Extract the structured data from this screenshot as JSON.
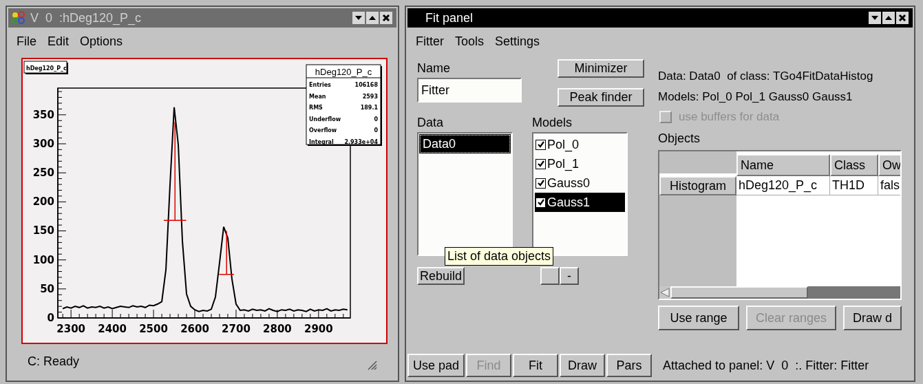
{
  "viewer": {
    "title": "V  0  :hDeg120_P_c",
    "menu": [
      "File",
      "Edit",
      "Options"
    ],
    "histogram": {
      "title_label": "hDeg120_P_c",
      "stats_title": "hDeg120_P_c",
      "stats": [
        {
          "label": "Entries",
          "value": "106168"
        },
        {
          "label": "Mean",
          "value": "2593"
        },
        {
          "label": "RMS",
          "value": "189.1"
        },
        {
          "label": "Underflow",
          "value": "0"
        },
        {
          "label": "Overflow",
          "value": "0"
        },
        {
          "label": "Integral",
          "value": "2.933e+04"
        }
      ],
      "chart_data": {
        "type": "line",
        "x": [
          2280,
          2290,
          2300,
          2310,
          2320,
          2330,
          2340,
          2350,
          2360,
          2370,
          2380,
          2390,
          2400,
          2410,
          2420,
          2430,
          2440,
          2450,
          2460,
          2470,
          2480,
          2490,
          2500,
          2510,
          2520,
          2530,
          2540,
          2550,
          2560,
          2570,
          2580,
          2590,
          2600,
          2610,
          2620,
          2630,
          2640,
          2650,
          2660,
          2670,
          2680,
          2690,
          2700,
          2710,
          2720,
          2730,
          2740,
          2750,
          2760,
          2770,
          2780,
          2790,
          2800,
          2810,
          2820,
          2830,
          2840,
          2850,
          2860,
          2870,
          2880,
          2890,
          2900,
          2910,
          2920,
          2930,
          2940,
          2950,
          2960,
          2970
        ],
        "series": [
          {
            "color": "#000000",
            "values": [
              16,
              19,
              17,
              20,
              18,
              21,
              17,
              19,
              18,
              20,
              17,
              19,
              16,
              18,
              20,
              19,
              18,
              21,
              19,
              20,
              18,
              22,
              21,
              24,
              28,
              83,
              230,
              363,
              298,
              132,
              41,
              20,
              14,
              11,
              13,
              12,
              15,
              36,
              95,
              157,
              138,
              67,
              24,
              13,
              14,
              12,
              15,
              13,
              14,
              12,
              16,
              13,
              11,
              14,
              13,
              15,
              12,
              14,
              13,
              11,
              15,
              12,
              14,
              13,
              16,
              12,
              14,
              13,
              15,
              14
            ]
          }
        ],
        "xlim": [
          2268,
          2977
        ],
        "ylim": [
          0,
          396
        ],
        "xticks": [
          2300,
          2400,
          2500,
          2600,
          2700,
          2800,
          2900
        ],
        "yticks": [
          0,
          50,
          100,
          150,
          200,
          250,
          300,
          350
        ]
      }
    },
    "status": "C: Ready"
  },
  "fit_panel": {
    "title": "Fit panel",
    "menu": [
      "Fitter",
      "Tools",
      "Settings"
    ],
    "name_label": "Name",
    "name_value": "Fitter",
    "top_buttons": [
      "Minimizer",
      "Peak finder"
    ],
    "data_label": "Data",
    "models_label": "Models",
    "data_items": [
      {
        "label": "Data0",
        "selected": true
      }
    ],
    "models": [
      {
        "label": "Pol_0",
        "checked": true,
        "selected": false
      },
      {
        "label": "Pol_1",
        "checked": true,
        "selected": false
      },
      {
        "label": "Gauss0",
        "checked": true,
        "selected": false
      },
      {
        "label": "Gauss1",
        "checked": true,
        "selected": true
      }
    ],
    "rebuild_button": "Rebuild",
    "remove_button": "-",
    "tooltip": "List of data objects",
    "data_info": "Data: Data0  of class: TGo4FitDataHistog",
    "models_info": "Models: Pol_0 Pol_1 Gauss0 Gauss1",
    "use_buffers": {
      "label": "use buffers for data",
      "checked": false,
      "disabled": true
    },
    "objects_label": "Objects",
    "table": {
      "columns": [
        "Name",
        "Class",
        "Ow"
      ],
      "rows": [
        {
          "header": "Histogram",
          "cells": [
            "hDeg120_P_c",
            "TH1D",
            "fals"
          ]
        }
      ]
    },
    "range_buttons": [
      {
        "label": "Use range",
        "disabled": false
      },
      {
        "label": "Clear ranges",
        "disabled": true
      },
      {
        "label": "Draw d",
        "disabled": false
      }
    ],
    "bottom_buttons": [
      {
        "label": "Use pad",
        "disabled": false
      },
      {
        "label": "Find",
        "disabled": true
      },
      {
        "label": "Fit",
        "disabled": false
      },
      {
        "label": "Draw",
        "disabled": false
      },
      {
        "label": "Pars",
        "disabled": false
      }
    ],
    "status": "Attached to panel: V  0  :. Fitter: Fitter"
  }
}
